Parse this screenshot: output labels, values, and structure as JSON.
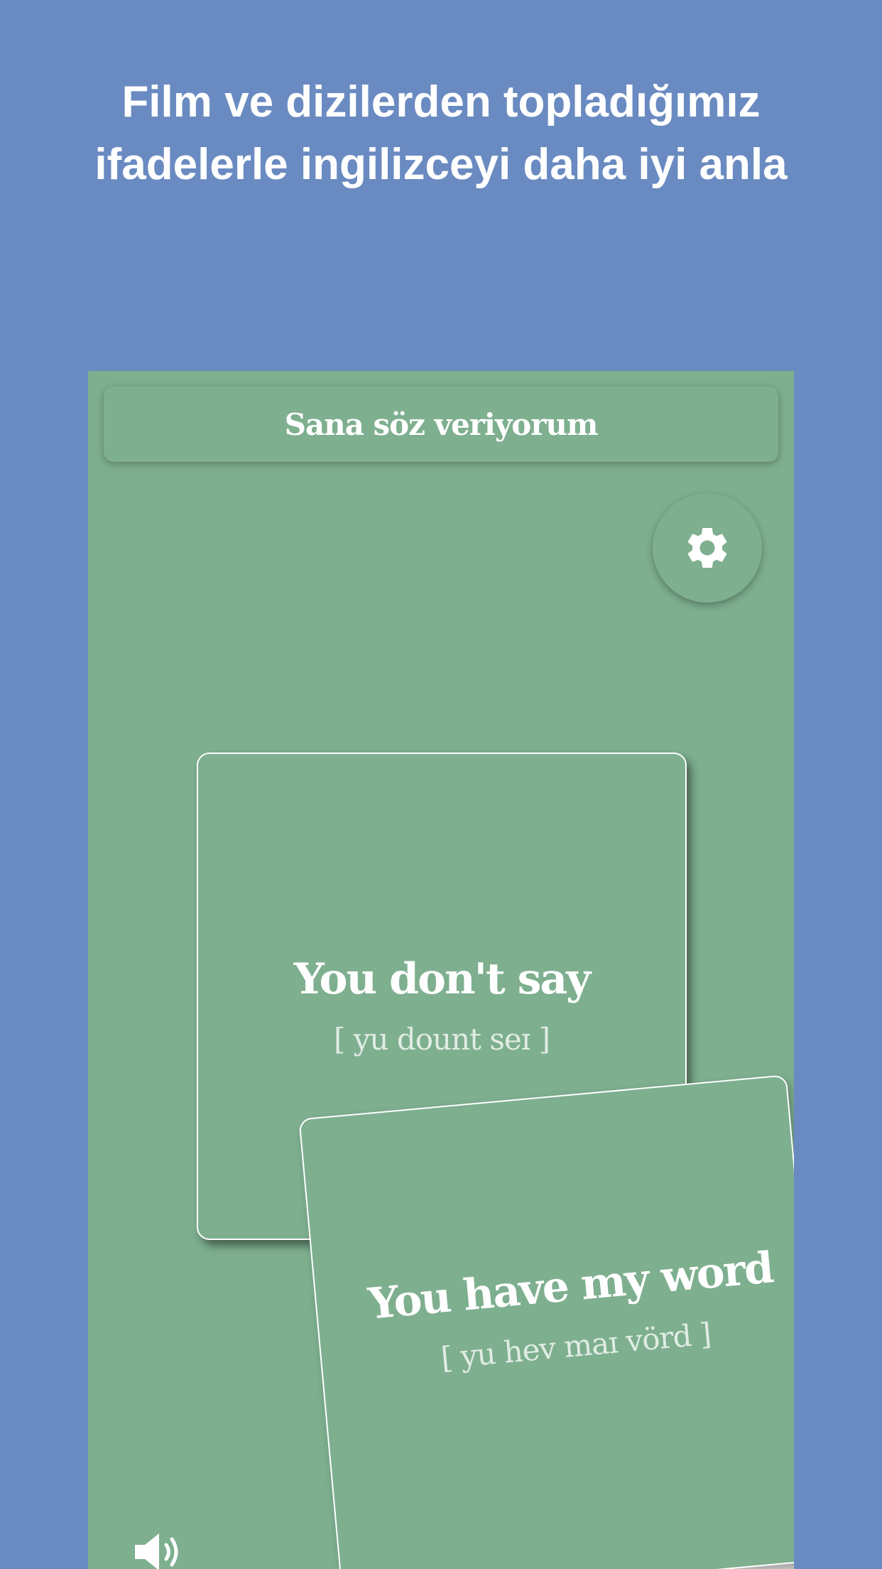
{
  "promo": {
    "headline_line1": "Film ve dizilerden topladığımız",
    "headline_line2": "ifadelerle ingilizceyi daha iyi anla"
  },
  "app": {
    "title": "Sana söz veriyorum",
    "settings_icon": "gear-icon",
    "sound_icon": "speaker-icon",
    "cards": [
      {
        "phrase": "You don't say",
        "pronunciation": "[ yu dount seɪ ]"
      },
      {
        "phrase": "You have my word",
        "pronunciation": "[ yu hev maɪ vörd ]"
      }
    ]
  },
  "colors": {
    "background": "#6a8bc1",
    "card": "#7eaf8f",
    "text": "#ffffff"
  }
}
